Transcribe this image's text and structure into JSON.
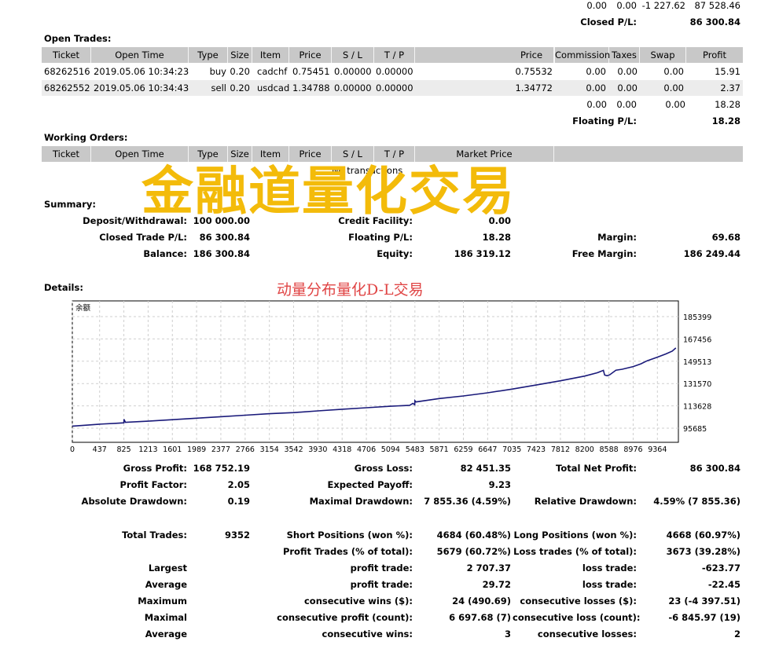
{
  "top_totals": {
    "row1": [
      "0.00",
      "0.00",
      "-1 227.62",
      "87 528.46"
    ],
    "closed_pl_label": "Closed P/L:",
    "closed_pl_value": "86 300.84"
  },
  "open_trades": {
    "title": "Open Trades:",
    "headers": [
      "Ticket",
      "Open Time",
      "Type",
      "Size",
      "Item",
      "Price",
      "S / L",
      "T / P",
      "",
      "Price",
      "Commission",
      "Taxes",
      "Swap",
      "Profit"
    ],
    "rows": [
      [
        "68262516",
        "2019.05.06 10:34:23",
        "buy",
        "0.20",
        "cadchf",
        "0.75451",
        "0.00000",
        "0.00000",
        "",
        "0.75532",
        "0.00",
        "0.00",
        "0.00",
        "15.91"
      ],
      [
        "68262552",
        "2019.05.06 10:34:43",
        "sell",
        "0.20",
        "usdcad",
        "1.34788",
        "0.00000",
        "0.00000",
        "",
        "1.34772",
        "0.00",
        "0.00",
        "0.00",
        "2.37"
      ]
    ],
    "totals": [
      "0.00",
      "0.00",
      "0.00",
      "18.28"
    ],
    "floating_label": "Floating P/L:",
    "floating_value": "18.28"
  },
  "working_orders": {
    "title": "Working Orders:",
    "headers": [
      "Ticket",
      "Open Time",
      "Type",
      "Size",
      "Item",
      "Price",
      "S / L",
      "T / P",
      "Market Price"
    ],
    "empty_text": "No transactions"
  },
  "watermark": {
    "main": "金融道量化交易",
    "sub": "动量分布量化D-L交易"
  },
  "summary": {
    "title": "Summary:",
    "deposit_label": "Deposit/Withdrawal:",
    "deposit_value": "100 000.00",
    "credit_label": "Credit Facility:",
    "credit_value": "0.00",
    "closed_trade_label": "Closed Trade P/L:",
    "closed_trade_value": "86 300.84",
    "floating_label": "Floating P/L:",
    "floating_value": "18.28",
    "margin_label": "Margin:",
    "margin_value": "69.68",
    "balance_label": "Balance:",
    "balance_value": "186 300.84",
    "equity_label": "Equity:",
    "equity_value": "186 319.12",
    "free_margin_label": "Free Margin:",
    "free_margin_value": "186 249.44"
  },
  "details": {
    "title": "Details:"
  },
  "chart_data": {
    "type": "line",
    "legend_text": "余额",
    "x_ticks": [
      0,
      437,
      825,
      1213,
      1601,
      1989,
      2377,
      2766,
      3154,
      3542,
      3930,
      4318,
      4706,
      5094,
      5483,
      5871,
      6259,
      6647,
      7035,
      7423,
      7812,
      8200,
      8588,
      8976,
      9364
    ],
    "y_ticks": [
      95685,
      113628,
      131570,
      149513,
      167456,
      185399
    ],
    "xlim": [
      0,
      9700
    ],
    "ylim": [
      95685,
      185399
    ],
    "grid": true,
    "series": [
      {
        "color": "#1a1a7a",
        "x": [
          0,
          200,
          437,
          700,
          825,
          826,
          850,
          1213,
          1601,
          1989,
          2377,
          2766,
          3154,
          3542,
          3930,
          4318,
          4706,
          5094,
          5400,
          5450,
          5480,
          5483,
          5500,
          5871,
          6259,
          6647,
          7035,
          7423,
          7812,
          8200,
          8400,
          8500,
          8520,
          8560,
          8600,
          8700,
          8800,
          8976,
          9100,
          9200,
          9364,
          9500,
          9600,
          9660
        ],
        "y": [
          97300,
          98000,
          98900,
          99600,
          100000,
          102800,
          100400,
          101300,
          102500,
          103700,
          104900,
          106100,
          107300,
          108200,
          109600,
          110900,
          112100,
          113300,
          114100,
          115600,
          114500,
          117800,
          116800,
          119500,
          121600,
          124100,
          127100,
          130400,
          133800,
          137600,
          140200,
          142200,
          138400,
          137800,
          138600,
          142300,
          143100,
          145200,
          147400,
          149900,
          152800,
          155400,
          157600,
          160200
        ]
      }
    ]
  },
  "stats": {
    "gross_profit_label": "Gross Profit:",
    "gross_profit_value": "168 752.19",
    "gross_loss_label": "Gross Loss:",
    "gross_loss_value": "82 451.35",
    "total_net_label": "Total Net Profit:",
    "total_net_value": "86 300.84",
    "profit_factor_label": "Profit Factor:",
    "profit_factor_value": "2.05",
    "expected_payoff_label": "Expected Payoff:",
    "expected_payoff_value": "9.23",
    "abs_dd_label": "Absolute Drawdown:",
    "abs_dd_value": "0.19",
    "max_dd_label": "Maximal Drawdown:",
    "max_dd_value": "7 855.36 (4.59%)",
    "rel_dd_label": "Relative Drawdown:",
    "rel_dd_value": "4.59% (7 855.36)",
    "total_trades_label": "Total Trades:",
    "total_trades_value": "9352",
    "short_label": "Short Positions (won %):",
    "short_value": "4684 (60.48%)",
    "long_label": "Long Positions (won %):",
    "long_value": "4668 (60.97%)",
    "profit_trades_label": "Profit Trades (% of total):",
    "profit_trades_value": "5679 (60.72%)",
    "loss_trades_label": "Loss trades (% of total):",
    "loss_trades_value": "3673 (39.28%)",
    "largest_label": "Largest",
    "largest_profit_label": "profit trade:",
    "largest_profit_value": "2 707.37",
    "largest_loss_label": "loss trade:",
    "largest_loss_value": "-623.77",
    "average_label": "Average",
    "avg_profit_label": "profit trade:",
    "avg_profit_value": "29.72",
    "avg_loss_label": "loss trade:",
    "avg_loss_value": "-22.45",
    "maximum_label": "Maximum",
    "max_wins_label": "consecutive wins ($):",
    "max_wins_value": "24 (490.69)",
    "max_losses_label": "consecutive losses ($):",
    "max_losses_value": "23 (-4 397.51)",
    "maximal_label": "Maximal",
    "maximal_profit_label": "consecutive profit (count):",
    "maximal_profit_value": "6 697.68 (7)",
    "maximal_loss_label": "consecutive loss (count):",
    "maximal_loss_value": "-6 845.97 (19)",
    "average2_label": "Average",
    "avg_wins_label": "consecutive wins:",
    "avg_wins_value": "3",
    "avg_losses_label": "consecutive losses:",
    "avg_losses_value": "2"
  }
}
